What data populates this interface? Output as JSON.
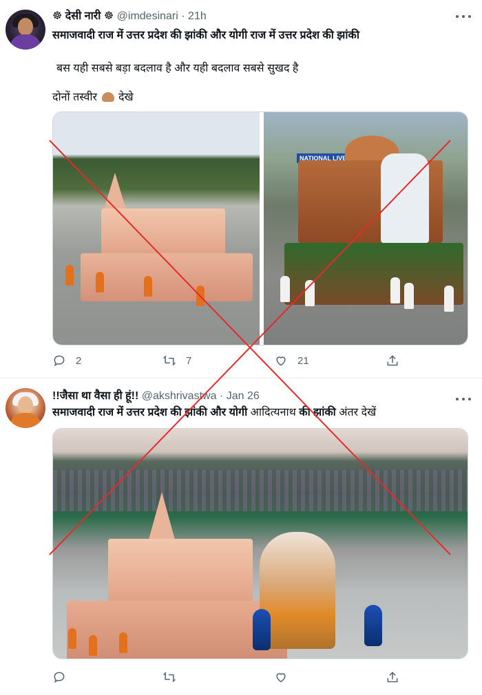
{
  "tweet1": {
    "name": "☸ देसी नारी ☸",
    "handle": "@imdesinari",
    "dot": "·",
    "time": "21h",
    "title": "समाजवादी राज में उत्तर प्रदेश की झांकी और योगी राज में उत्तर प्रदेश की झांकी",
    "line1": "बस यही सबसे बड़ा बदलाव है और यही बदलाव सबसे सुखद है",
    "line2_a": "दोनों तस्वीर",
    "line2_b": "देखे",
    "badge": "NATIONAL LIVE",
    "reply_count": "2",
    "retweet_count": "7",
    "like_count": "21"
  },
  "tweet2": {
    "name": "!!जैसा था वैसा ही हूं!!",
    "handle": "@akshrivastwa",
    "dot": "·",
    "time": "Jan 26",
    "title_bold1": "समाजवादी राज में उत्तर प्रदेश की झांकी और योगी",
    "title_reg1": " आदित्यनाथ ",
    "title_bold2": "की झांकी",
    "title_reg2": " अंतर देखें"
  },
  "colors": {
    "cross": "#e52a2a",
    "muted": "#536471",
    "text": "#0f1419"
  },
  "icons": [
    "more-icon",
    "reply-icon",
    "retweet-icon",
    "like-icon",
    "share-icon",
    "pointing-finger-icon"
  ]
}
